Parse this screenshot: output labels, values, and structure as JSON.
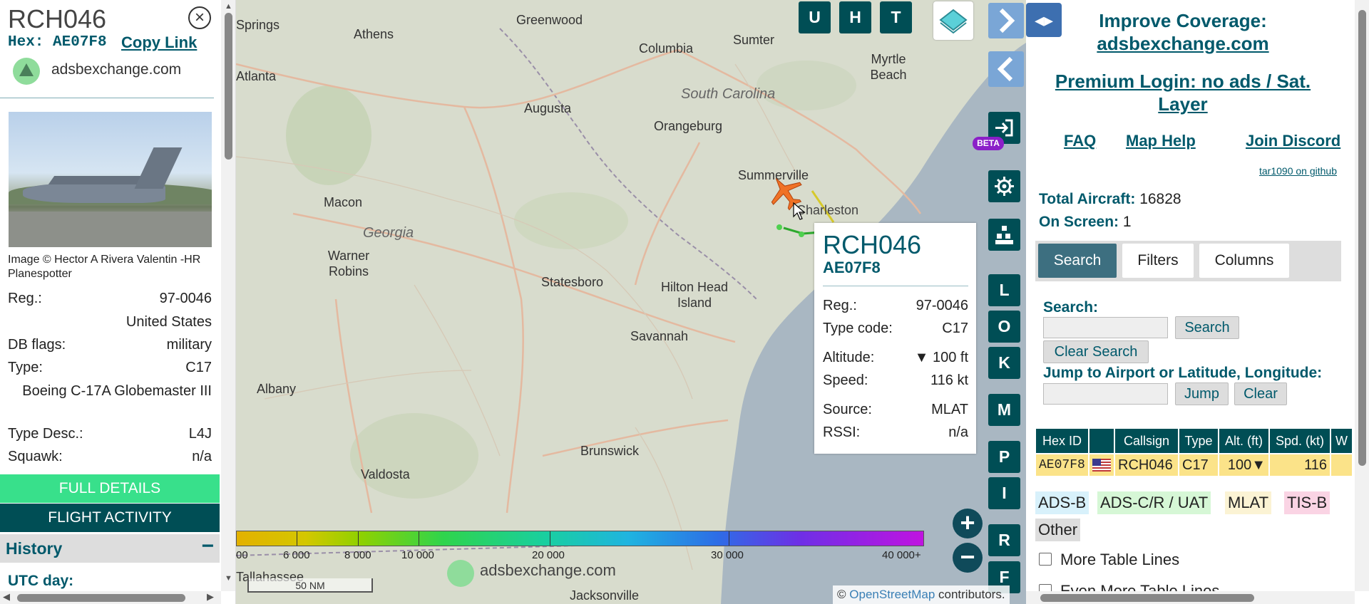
{
  "left_panel": {
    "callsign": "RCH046",
    "close_glyph": "×",
    "hex_label": "Hex: AE07F8",
    "copy_link": "Copy Link",
    "logo_text": "adsbexchange.com",
    "photo_caption": "Image © Hector A Rivera Valentin -HR Planespotter",
    "reg_label": "Reg.:",
    "reg_value": "97-0046",
    "country": "United States",
    "dbflags_label": "DB flags:",
    "dbflags_value": "military",
    "type_label": "Type:",
    "type_value": "C17",
    "type_full": "Boeing C-17A Globemaster III",
    "typedesc_label": "Type Desc.:",
    "typedesc_value": "L4J",
    "squawk_label": "Squawk:",
    "squawk_value": "n/a",
    "full_details": "FULL DETAILS",
    "flight_activity": "FLIGHT ACTIVITY",
    "history": "History",
    "history_toggle": "−",
    "utc_day": "UTC day:"
  },
  "map": {
    "labels": [
      "Greenwood",
      "Athens",
      "Sumter",
      "Myrtle Beach",
      "Columbia",
      "Augusta",
      "South Carolina",
      "Orangeburg",
      "Summerville",
      "Charleston",
      "Macon",
      "Georgia",
      "Warner Robins",
      "Statesboro",
      "Hilton Head Island",
      "Savannah",
      "Albany",
      "Brunswick",
      "Valdosta",
      "Tallahassee",
      "Jacksonville",
      "Springs",
      "Atlanta"
    ],
    "controls": {
      "u": "U",
      "h": "H",
      "t": "T",
      "l": "L",
      "o": "O",
      "k": "K",
      "m": "M",
      "p": "P",
      "i": "I",
      "r": "R",
      "f": "F",
      "beta": "BETA",
      "zoom_in": "+",
      "zoom_out": "−"
    },
    "altitude_ticks": [
      "00",
      "6 000",
      "8 000",
      "10 000",
      "20 000",
      "30 000",
      "40 000+"
    ],
    "scale_label": "50 NM",
    "watermark": "adsbexchange.com",
    "attribution_prefix": "©",
    "attribution_link": "OpenStreetMap",
    "attribution_suffix": "contributors.",
    "tooltip": {
      "callsign": "RCH046",
      "hex": "AE07F8",
      "reg_label": "Reg.:",
      "reg_value": "97-0046",
      "type_label": "Type code:",
      "type_value": "C17",
      "alt_label": "Altitude:",
      "alt_value": "▼ 100 ft",
      "speed_label": "Speed:",
      "speed_value": "116 kt",
      "source_label": "Source:",
      "source_value": "MLAT",
      "rssi_label": "RSSI:",
      "rssi_value": "n/a"
    }
  },
  "right_panel": {
    "toggle_glyph": "◂▸",
    "improve_line1": "Improve Coverage:",
    "improve_line2": "adsbexchange.com",
    "premium_line1": "Premium Login: no ads / Sat.",
    "premium_line2": "Layer",
    "faq": "FAQ",
    "map_help": "Map Help",
    "join_discord": "Join Discord",
    "github": "tar1090 on github",
    "total_label": "Total Aircraft:",
    "total_value": "16828",
    "onscreen_label": "On Screen:",
    "onscreen_value": "1",
    "tabs": [
      "Search",
      "Filters",
      "Columns"
    ],
    "search_label": "Search:",
    "search_button": "Search",
    "clear_search": "Clear Search",
    "jump_label": "Jump to Airport or Latitude, Longitude:",
    "jump_button": "Jump",
    "clear_button": "Clear",
    "table_headers": [
      "Hex ID",
      "",
      "Callsign",
      "Type",
      "Alt. (ft)",
      "Spd. (kt)",
      "W"
    ],
    "table_row": {
      "hex": "AE07F8",
      "callsign": "RCH046",
      "type": "C17",
      "alt": "100▼",
      "spd": "116"
    },
    "legend": [
      "ADS-B",
      "ADS-C/R / UAT",
      "MLAT",
      "TIS-B",
      "Other"
    ],
    "legend_colors": [
      "#d8f1fb",
      "#d6f7d6",
      "#fbf3d4",
      "#fad4e4",
      "#ddd"
    ],
    "more_lines": "More Table Lines",
    "even_more_lines": "Even More Table Lines"
  }
}
